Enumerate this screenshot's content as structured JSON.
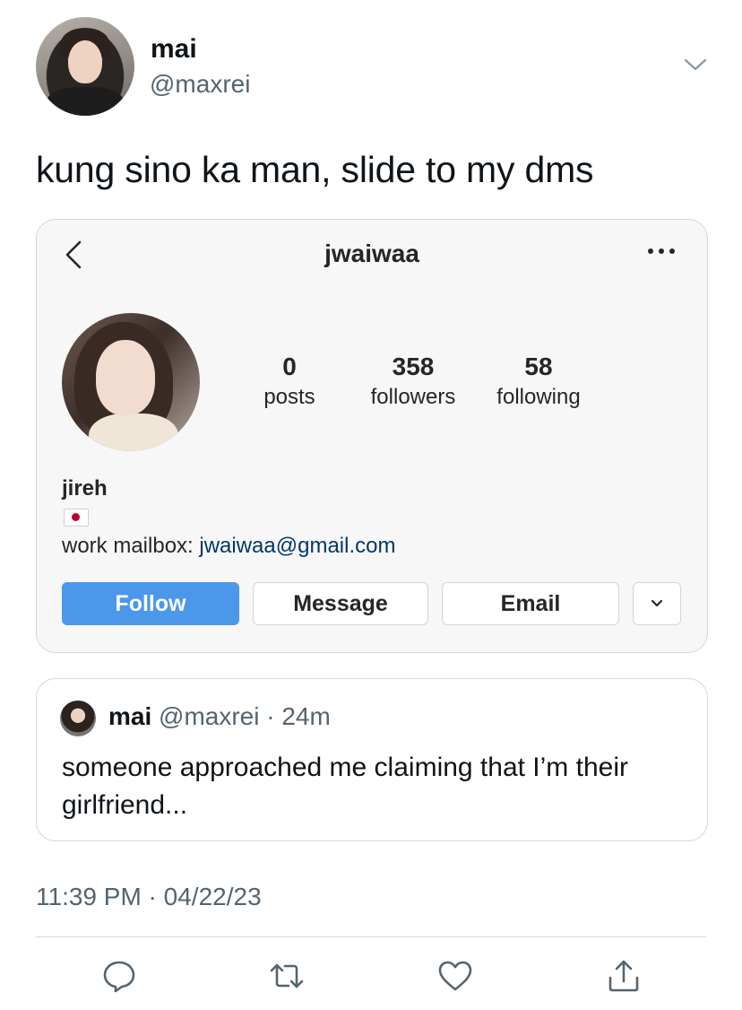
{
  "tweet": {
    "display_name": "mai",
    "handle": "@maxrei",
    "text": "kung sino ka man, slide to my dms",
    "timestamp": "11:39 PM · 04/22/23"
  },
  "instagram": {
    "username": "jwaiwaa",
    "stats": {
      "posts_count": "0",
      "posts_label": "posts",
      "followers_count": "358",
      "followers_label": "followers",
      "following_count": "58",
      "following_label": "following"
    },
    "name": "jireh",
    "bio_prefix": "work mailbox: ",
    "bio_link": "jwaiwaa@gmail.com",
    "buttons": {
      "follow": "Follow",
      "message": "Message",
      "email": "Email"
    }
  },
  "quote": {
    "display_name": "mai",
    "meta": "@maxrei · 24m",
    "text": "someone approached me claiming that I’m their girlfriend..."
  },
  "colors": {
    "follow_button": "#4b97ea",
    "secondary_text": "#536471",
    "link": "#00376b",
    "border": "#cfd9de"
  },
  "icons": {
    "tweet_menu": "chevron-down-icon",
    "ig_back": "chevron-left-icon",
    "ig_more": "more-horizontal-icon",
    "flag": "japan-flag-icon",
    "reply": "reply-icon",
    "retweet": "retweet-icon",
    "like": "heart-icon",
    "share": "share-icon"
  }
}
